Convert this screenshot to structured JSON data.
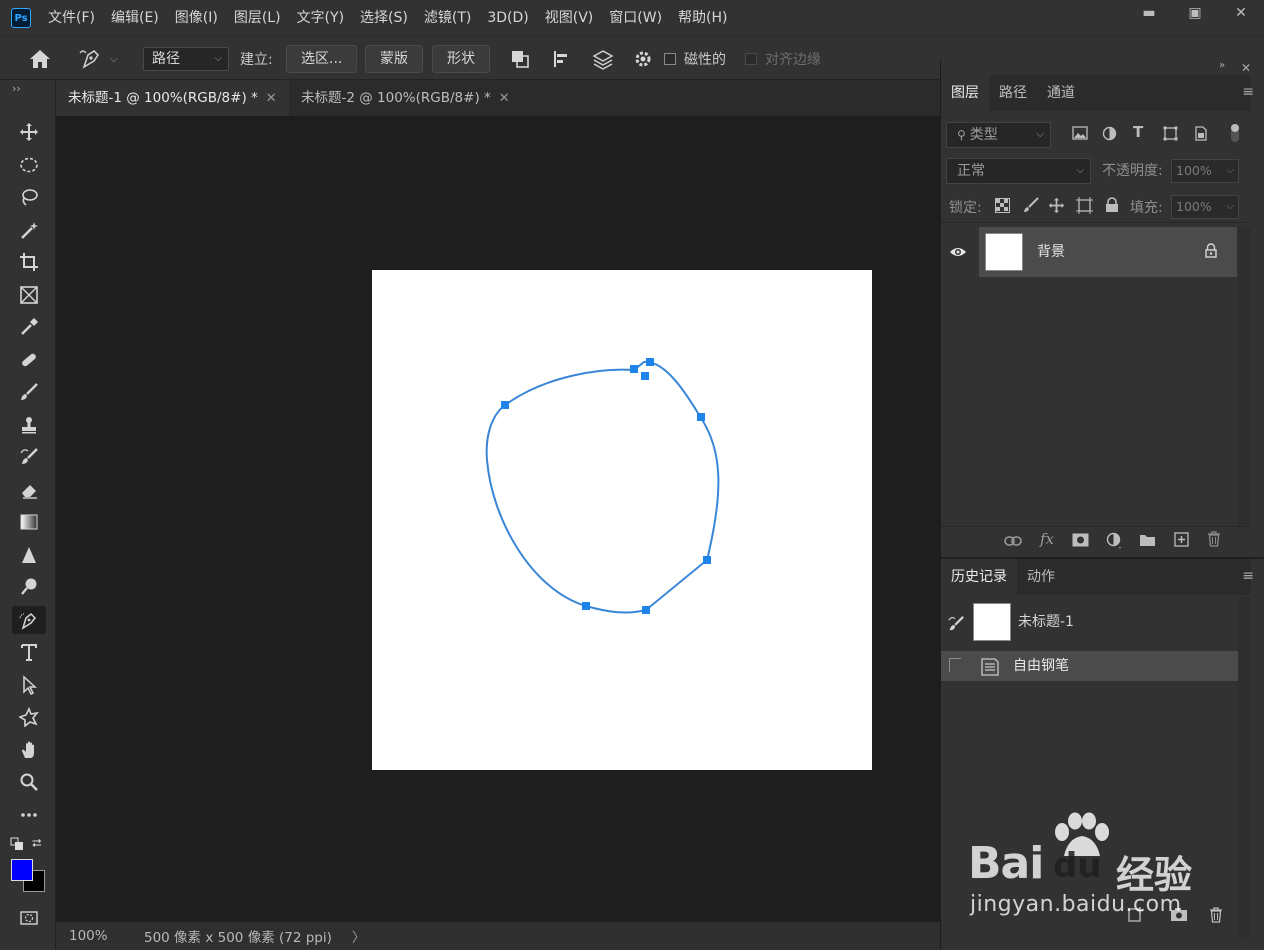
{
  "app": {
    "logo": "Ps"
  },
  "menu": [
    "文件(F)",
    "编辑(E)",
    "图像(I)",
    "图层(L)",
    "文字(Y)",
    "选择(S)",
    "滤镜(T)",
    "3D(D)",
    "视图(V)",
    "窗口(W)",
    "帮助(H)"
  ],
  "window_controls": {
    "minimize": "▬",
    "maximize": "▣",
    "close": "✕"
  },
  "options": {
    "mode_value": "路径",
    "make_label": "建立:",
    "selection_btn": "选区...",
    "mask_btn": "蒙版",
    "shape_btn": "形状",
    "magnetic_label": "磁性的",
    "align_edges_label": "对齐边缘"
  },
  "tabs": [
    {
      "label": "未标题-1 @ 100%(RGB/8#) *",
      "active": true
    },
    {
      "label": "未标题-2 @ 100%(RGB/8#) *",
      "active": false
    }
  ],
  "tools": [
    "move-icon",
    "marquee-icon",
    "lasso-icon",
    "magic-wand-icon",
    "crop-icon",
    "frame-icon",
    "eyedropper-icon",
    "healing-brush-icon",
    "brush-icon",
    "stamp-icon",
    "history-brush-icon",
    "eraser-icon",
    "gradient-icon",
    "blur-icon",
    "dodge-icon",
    "freeform-pen-icon",
    "type-icon",
    "path-select-icon",
    "custom-shape-icon",
    "hand-icon",
    "zoom-icon",
    "more-icon"
  ],
  "colors": {
    "foreground": "#0000ff",
    "background": "#000000",
    "path": "#3a86d6"
  },
  "status": {
    "zoom": "100%",
    "doc_info": "500 像素 x 500 像素 (72 ppi)",
    "arrow": "〉"
  },
  "layers_panel": {
    "tabs": [
      "图层",
      "路径",
      "通道"
    ],
    "filter_placeholder": "类型",
    "blend_mode": "正常",
    "opacity_label": "不透明度:",
    "opacity_value": "100%",
    "lock_label": "锁定:",
    "fill_label": "填充:",
    "fill_value": "100%",
    "layers": [
      {
        "name": "背景",
        "visible": true,
        "locked": true
      }
    ]
  },
  "history_panel": {
    "tabs": [
      "历史记录",
      "动作"
    ],
    "snapshot_name": "未标题-1",
    "items": [
      {
        "name": "自由钢笔",
        "selected": true
      }
    ]
  },
  "watermark": {
    "brand": "Bai",
    "brand_du": "du",
    "cn": "经验",
    "url": "jingyan.baidu.com"
  }
}
